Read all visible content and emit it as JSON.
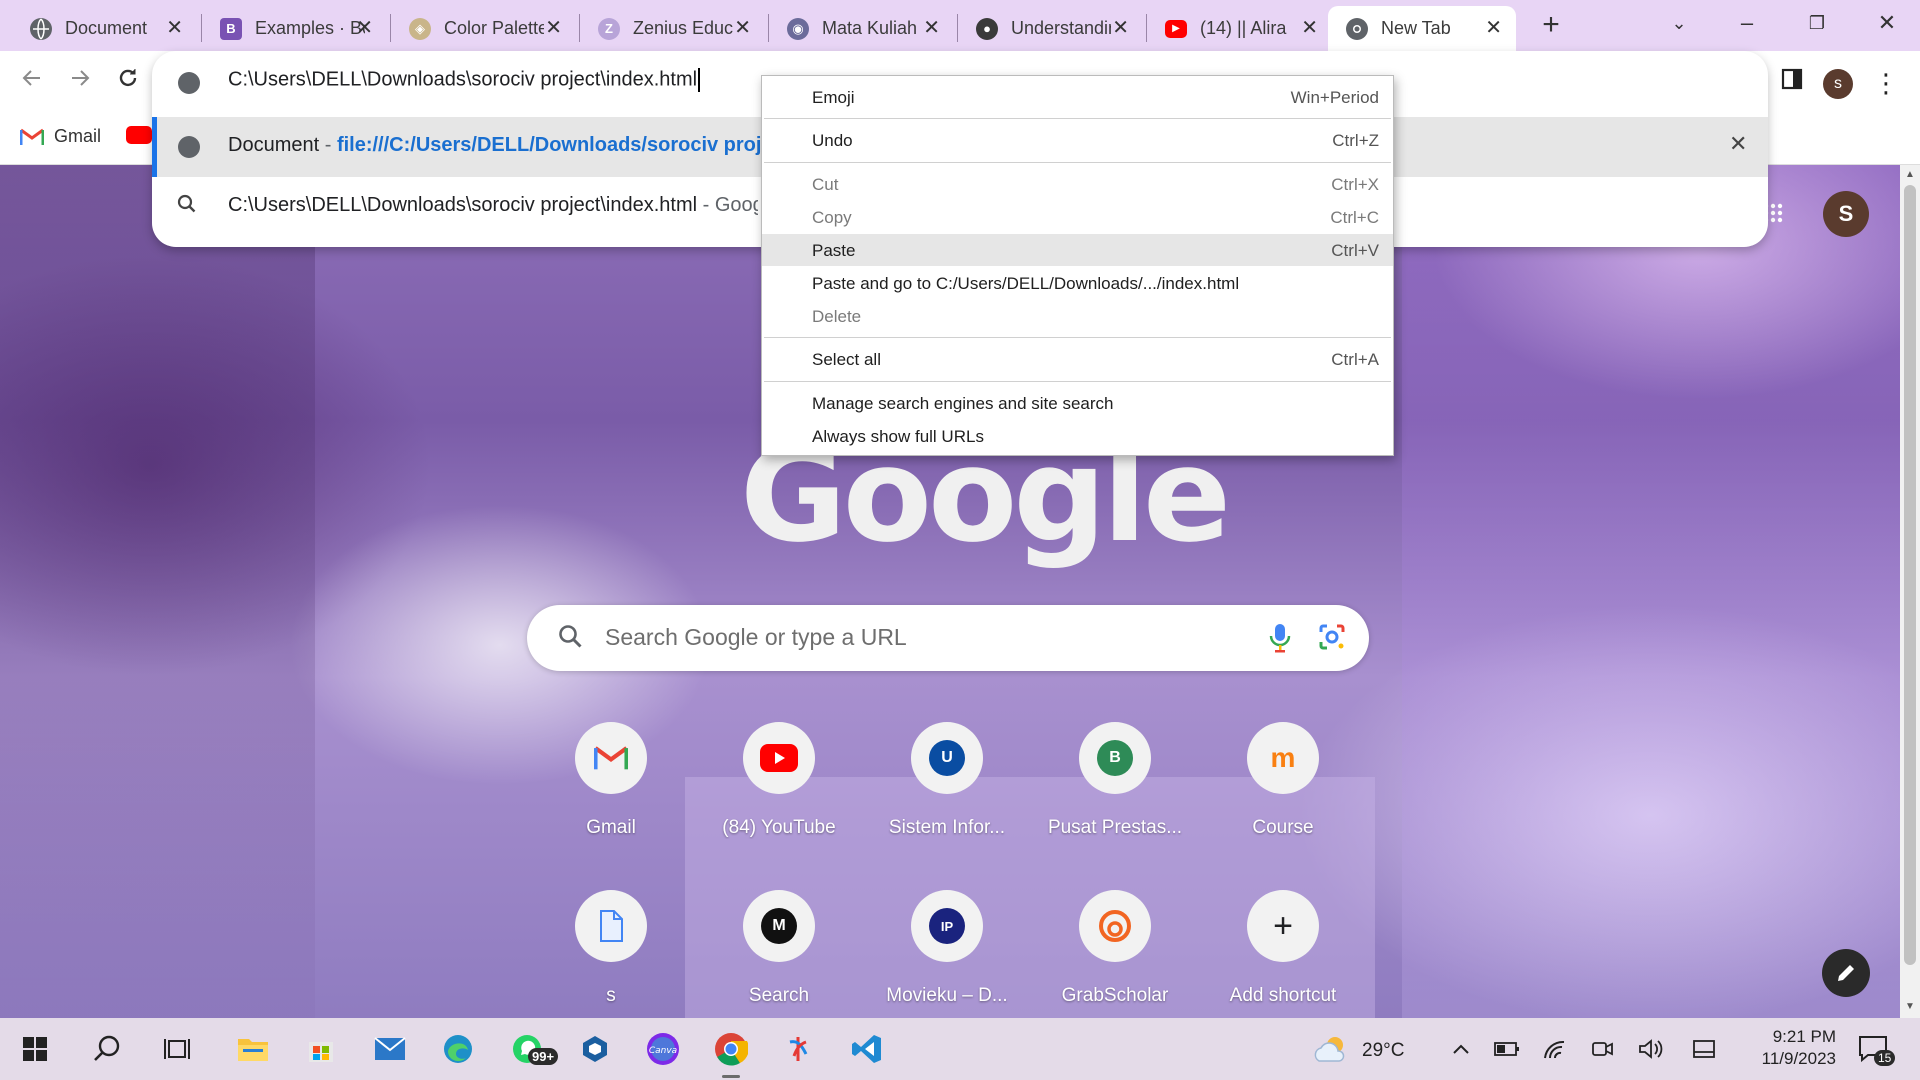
{
  "tabs": [
    {
      "title": "Document",
      "icon": "globe-icon"
    },
    {
      "title": "Examples · Bootstrap",
      "icon": "bootstrap-icon"
    },
    {
      "title": "Color Palette",
      "icon": "palette-icon"
    },
    {
      "title": "Zenius Education",
      "icon": "zenius-icon"
    },
    {
      "title": "Mata Kuliah",
      "icon": "course-icon"
    },
    {
      "title": "Understanding",
      "icon": "github-icon"
    },
    {
      "title": "(14) || Alira",
      "icon": "youtube-icon"
    },
    {
      "title": "New Tab",
      "icon": "chrome-icon",
      "active": true
    }
  ],
  "omnibox": {
    "input_value": "C:\\Users\\DELL\\Downloads\\sorociv project\\index.html",
    "suggestions": [
      {
        "title": "Document",
        "separator": " - ",
        "url": "file:///C:/Users/DELL/Downloads/sorociv project/index.html",
        "selected": true
      },
      {
        "title": "C:\\Users\\DELL\\Downloads\\sorociv project\\index.html",
        "separator": " - ",
        "url": "Google Search"
      }
    ]
  },
  "bookmarks": [
    {
      "label": "Gmail",
      "icon": "gmail-icon"
    },
    {
      "label": "",
      "icon": "youtube-icon"
    }
  ],
  "context_menu": {
    "items": [
      {
        "label": "Emoji",
        "shortcut": "Win+Period"
      },
      {
        "label": "Undo",
        "shortcut": "Ctrl+Z"
      },
      {
        "label": "Cut",
        "shortcut": "Ctrl+X",
        "disabled": true
      },
      {
        "label": "Copy",
        "shortcut": "Ctrl+C",
        "disabled": true
      },
      {
        "label": "Paste",
        "shortcut": "Ctrl+V",
        "highlighted": true
      },
      {
        "label": "Paste and go to C:/Users/DELL/Downloads/.../index.html",
        "shortcut": ""
      },
      {
        "label": "Delete",
        "shortcut": "",
        "disabled": true
      },
      {
        "label": "Select all",
        "shortcut": "Ctrl+A"
      },
      {
        "label": "Manage search engines and site search",
        "shortcut": ""
      },
      {
        "label": "Always show full URLs",
        "shortcut": ""
      }
    ]
  },
  "page": {
    "logo_text": "Google",
    "search_placeholder": "Search Google or type a URL",
    "avatar_letter": "S",
    "shortcuts": [
      {
        "label": "Gmail",
        "icon": "gmail-icon"
      },
      {
        "label": "(84) YouTube",
        "icon": "youtube-icon"
      },
      {
        "label": "Sistem Infor...",
        "icon": "letter-u-icon",
        "letter": "U",
        "color": "#0a4da2"
      },
      {
        "label": "Pusat Prestas...",
        "icon": "letter-b-icon",
        "letter": "B",
        "color": "#2e8b57"
      },
      {
        "label": "Course",
        "icon": "moodle-icon"
      },
      {
        "label": "s",
        "icon": "document-icon"
      },
      {
        "label": "Search",
        "icon": "letter-m-icon",
        "letter": "M",
        "color": "#111111"
      },
      {
        "label": "Movieku – D...",
        "icon": "letter-ip-icon",
        "letter": "IP",
        "color": "#1a237e"
      },
      {
        "label": "GrabScholar",
        "icon": "grabscholar-icon"
      },
      {
        "label": "Add shortcut",
        "icon": "plus-icon"
      }
    ]
  },
  "profile": {
    "letter": "s"
  },
  "taskbar": {
    "whatsapp_badge": "99+",
    "temperature": "29°C",
    "time": "9:21 PM",
    "date": "11/9/2023",
    "notifications": "15"
  },
  "colors": {
    "tabstrip_bg": "#e8d5f5",
    "accent_blue": "#1a73e8",
    "taskbar_bg": "#e4dbe8"
  }
}
